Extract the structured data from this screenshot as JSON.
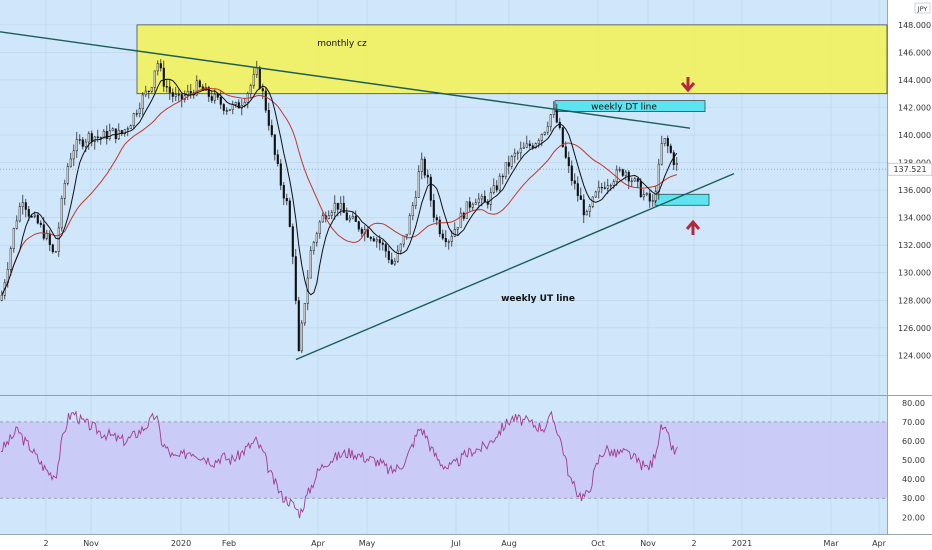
{
  "chart_data": {
    "type": "candlestick",
    "currency": "JPY",
    "x_ticks": [
      "2",
      "Nov",
      "2020",
      "Feb",
      "Apr",
      "May",
      "Jul",
      "Aug",
      "Oct",
      "Nov",
      "2",
      "2021",
      "Mar",
      "Apr"
    ],
    "y_ticks": [
      "124.000",
      "126.000",
      "128.000",
      "130.000",
      "132.000",
      "134.000",
      "136.000",
      "138.000",
      "140.000",
      "142.000",
      "144.000",
      "146.000",
      "148.000"
    ],
    "ylim": [
      122.5,
      148.5
    ],
    "last_price": "137.521",
    "zones": [
      {
        "label": "monthly cz",
        "y_range": [
          143.0,
          148.0
        ],
        "color": "#f2f25c"
      },
      {
        "label": "weekly DT line",
        "y_range": [
          141.7,
          142.5
        ],
        "color": "#4fe3ef"
      },
      {
        "label": "",
        "y_range": [
          134.9,
          135.7
        ],
        "color": "#4fe3ef"
      }
    ],
    "trendlines": [
      {
        "label": "",
        "type": "down",
        "from": [
          0,
          147.5
        ],
        "to": [
          690,
          140.5
        ]
      },
      {
        "label": "weekly UT line",
        "type": "up",
        "from": [
          296,
          123.7
        ],
        "to": [
          734,
          137.2
        ]
      }
    ],
    "arrows": [
      {
        "direction": "down",
        "color": "#b5273f"
      },
      {
        "direction": "up",
        "color": "#b5273f"
      }
    ],
    "price_anchors": [
      [
        0,
        128.0
      ],
      [
        8,
        131.0
      ],
      [
        14,
        133.5
      ],
      [
        22,
        135.5
      ],
      [
        30,
        134.0
      ],
      [
        38,
        133.5
      ],
      [
        46,
        132.5
      ],
      [
        54,
        131.0
      ],
      [
        60,
        134.5
      ],
      [
        66,
        137.5
      ],
      [
        72,
        139.0
      ],
      [
        80,
        139.5
      ],
      [
        90,
        140.0
      ],
      [
        100,
        139.8
      ],
      [
        110,
        140.2
      ],
      [
        120,
        140.0
      ],
      [
        130,
        141.0
      ],
      [
        140,
        142.5
      ],
      [
        150,
        143.5
      ],
      [
        156,
        145.5
      ],
      [
        162,
        144.0
      ],
      [
        170,
        143.0
      ],
      [
        178,
        142.5
      ],
      [
        188,
        143.0
      ],
      [
        196,
        143.5
      ],
      [
        206,
        143.0
      ],
      [
        216,
        142.5
      ],
      [
        226,
        142.0
      ],
      [
        236,
        142.0
      ],
      [
        246,
        143.0
      ],
      [
        256,
        144.5
      ],
      [
        262,
        143.0
      ],
      [
        268,
        141.0
      ],
      [
        274,
        138.5
      ],
      [
        280,
        136.5
      ],
      [
        286,
        135.0
      ],
      [
        292,
        131.5
      ],
      [
        298,
        124.0
      ],
      [
        304,
        128.0
      ],
      [
        310,
        131.5
      ],
      [
        318,
        133.5
      ],
      [
        326,
        134.5
      ],
      [
        336,
        135.0
      ],
      [
        346,
        134.0
      ],
      [
        356,
        133.5
      ],
      [
        366,
        133.0
      ],
      [
        376,
        132.5
      ],
      [
        386,
        131.5
      ],
      [
        392,
        130.5
      ],
      [
        398,
        131.5
      ],
      [
        406,
        133.0
      ],
      [
        414,
        135.5
      ],
      [
        420,
        138.0
      ],
      [
        426,
        137.0
      ],
      [
        432,
        134.5
      ],
      [
        440,
        133.0
      ],
      [
        448,
        132.5
      ],
      [
        456,
        133.5
      ],
      [
        464,
        134.5
      ],
      [
        474,
        135.5
      ],
      [
        484,
        135.0
      ],
      [
        494,
        136.0
      ],
      [
        504,
        137.5
      ],
      [
        514,
        138.5
      ],
      [
        524,
        139.0
      ],
      [
        534,
        139.5
      ],
      [
        544,
        140.5
      ],
      [
        552,
        141.8
      ],
      [
        558,
        140.5
      ],
      [
        564,
        138.5
      ],
      [
        570,
        137.0
      ],
      [
        578,
        135.5
      ],
      [
        586,
        134.0
      ],
      [
        594,
        135.5
      ],
      [
        604,
        136.5
      ],
      [
        614,
        137.0
      ],
      [
        624,
        137.5
      ],
      [
        634,
        136.5
      ],
      [
        644,
        135.5
      ],
      [
        652,
        135.0
      ],
      [
        658,
        137.5
      ],
      [
        662,
        139.8
      ],
      [
        668,
        139.0
      ],
      [
        674,
        138.0
      ],
      [
        678,
        137.5
      ]
    ],
    "ma_short_color": "#111111",
    "ma_long_color": "#c0392b",
    "rsi": {
      "x_ticks_shared": true,
      "y_ticks": [
        "20.00",
        "30.00",
        "40.00",
        "50.00",
        "60.00",
        "70.00",
        "80.00"
      ],
      "ylim": [
        17.0,
        82.0
      ],
      "band": [
        30,
        70
      ],
      "band_color": "#c8c2f5",
      "line_color": "#a03c8c",
      "anchors": [
        [
          0,
          55
        ],
        [
          6,
          58
        ],
        [
          12,
          62
        ],
        [
          18,
          66
        ],
        [
          24,
          60
        ],
        [
          30,
          57
        ],
        [
          36,
          52
        ],
        [
          44,
          46
        ],
        [
          50,
          43
        ],
        [
          56,
          42
        ],
        [
          62,
          60
        ],
        [
          68,
          72
        ],
        [
          74,
          75
        ],
        [
          80,
          71
        ],
        [
          86,
          69
        ],
        [
          94,
          67
        ],
        [
          102,
          64
        ],
        [
          110,
          63
        ],
        [
          118,
          61
        ],
        [
          126,
          60
        ],
        [
          134,
          63
        ],
        [
          142,
          66
        ],
        [
          150,
          70
        ],
        [
          156,
          74
        ],
        [
          162,
          59
        ],
        [
          168,
          55
        ],
        [
          174,
          51
        ],
        [
          182,
          52
        ],
        [
          190,
          55
        ],
        [
          198,
          53
        ],
        [
          206,
          51
        ],
        [
          214,
          49
        ],
        [
          222,
          52
        ],
        [
          230,
          50
        ],
        [
          238,
          52
        ],
        [
          246,
          56
        ],
        [
          256,
          60
        ],
        [
          264,
          53
        ],
        [
          270,
          43
        ],
        [
          276,
          37
        ],
        [
          282,
          31
        ],
        [
          288,
          29
        ],
        [
          294,
          26
        ],
        [
          300,
          22
        ],
        [
          306,
          30
        ],
        [
          312,
          37
        ],
        [
          318,
          44
        ],
        [
          326,
          49
        ],
        [
          334,
          51
        ],
        [
          342,
          53
        ],
        [
          350,
          54
        ],
        [
          358,
          53
        ],
        [
          366,
          51
        ],
        [
          374,
          50
        ],
        [
          382,
          48
        ],
        [
          390,
          44
        ],
        [
          398,
          46
        ],
        [
          406,
          50
        ],
        [
          414,
          60
        ],
        [
          420,
          67
        ],
        [
          426,
          63
        ],
        [
          432,
          55
        ],
        [
          440,
          49
        ],
        [
          448,
          46
        ],
        [
          456,
          48
        ],
        [
          464,
          52
        ],
        [
          472,
          55
        ],
        [
          480,
          56
        ],
        [
          488,
          58
        ],
        [
          496,
          63
        ],
        [
          504,
          68
        ],
        [
          512,
          72
        ],
        [
          520,
          71
        ],
        [
          528,
          70
        ],
        [
          536,
          68
        ],
        [
          544,
          67
        ],
        [
          552,
          73
        ],
        [
          558,
          65
        ],
        [
          564,
          54
        ],
        [
          570,
          40
        ],
        [
          576,
          34
        ],
        [
          582,
          31
        ],
        [
          588,
          32
        ],
        [
          594,
          43
        ],
        [
          600,
          52
        ],
        [
          606,
          56
        ],
        [
          614,
          53
        ],
        [
          622,
          54
        ],
        [
          630,
          53
        ],
        [
          638,
          49
        ],
        [
          646,
          46
        ],
        [
          652,
          48
        ],
        [
          658,
          60
        ],
        [
          662,
          68
        ],
        [
          668,
          62
        ],
        [
          674,
          54
        ],
        [
          678,
          55
        ]
      ]
    }
  }
}
